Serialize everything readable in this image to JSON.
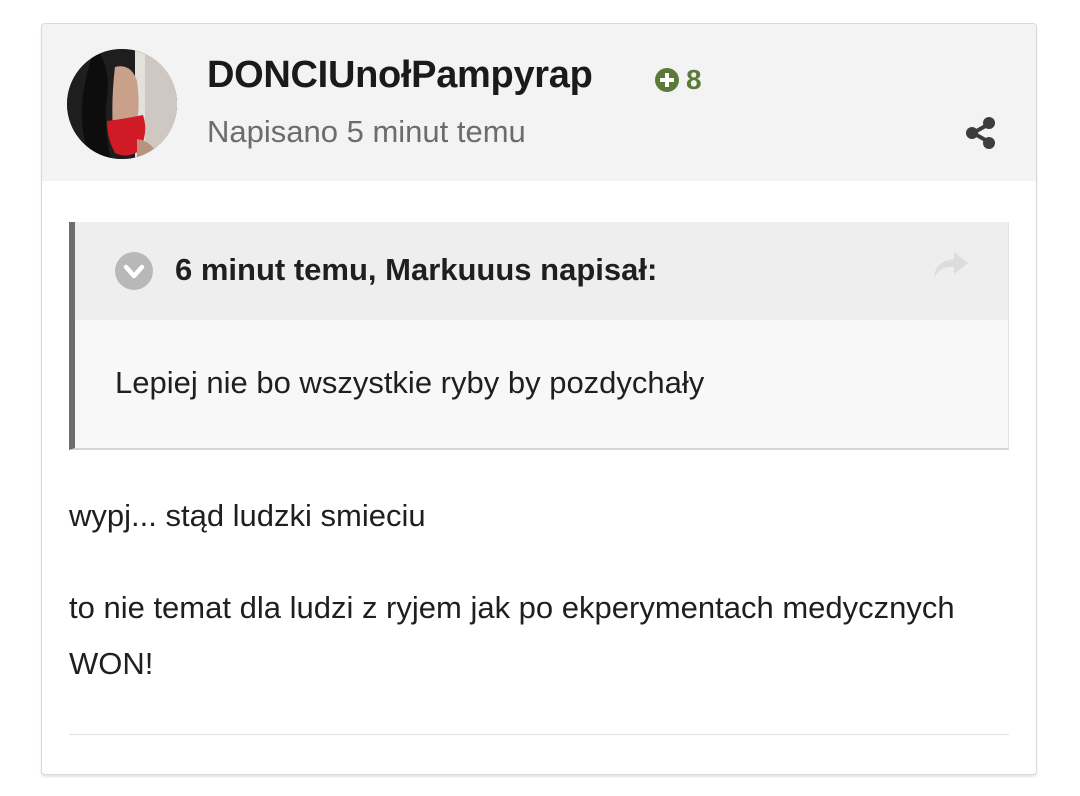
{
  "post": {
    "author": "DONCIUnołPampyrap",
    "reputation": "8",
    "timestamp": "Napisano 5 minut temu",
    "icons": {
      "reputation": "plus-circle-icon",
      "share": "share-icon"
    },
    "colors": {
      "reputation": "#5a7a3a",
      "header_bg": "#f3f3f3"
    }
  },
  "quote": {
    "citation": "6 minut temu, Markuuus napisał:",
    "text": "Lepiej nie bo wszystkie ryby by pozdychały",
    "icons": {
      "toggle": "chevron-down-circle-icon",
      "link": "share-arrow-icon"
    }
  },
  "content": {
    "paragraph_1": "wypj... stąd ludzki smieciu",
    "paragraph_2": "to nie temat dla ludzi z ryjem jak po ekperymentach medycznych WON!"
  }
}
